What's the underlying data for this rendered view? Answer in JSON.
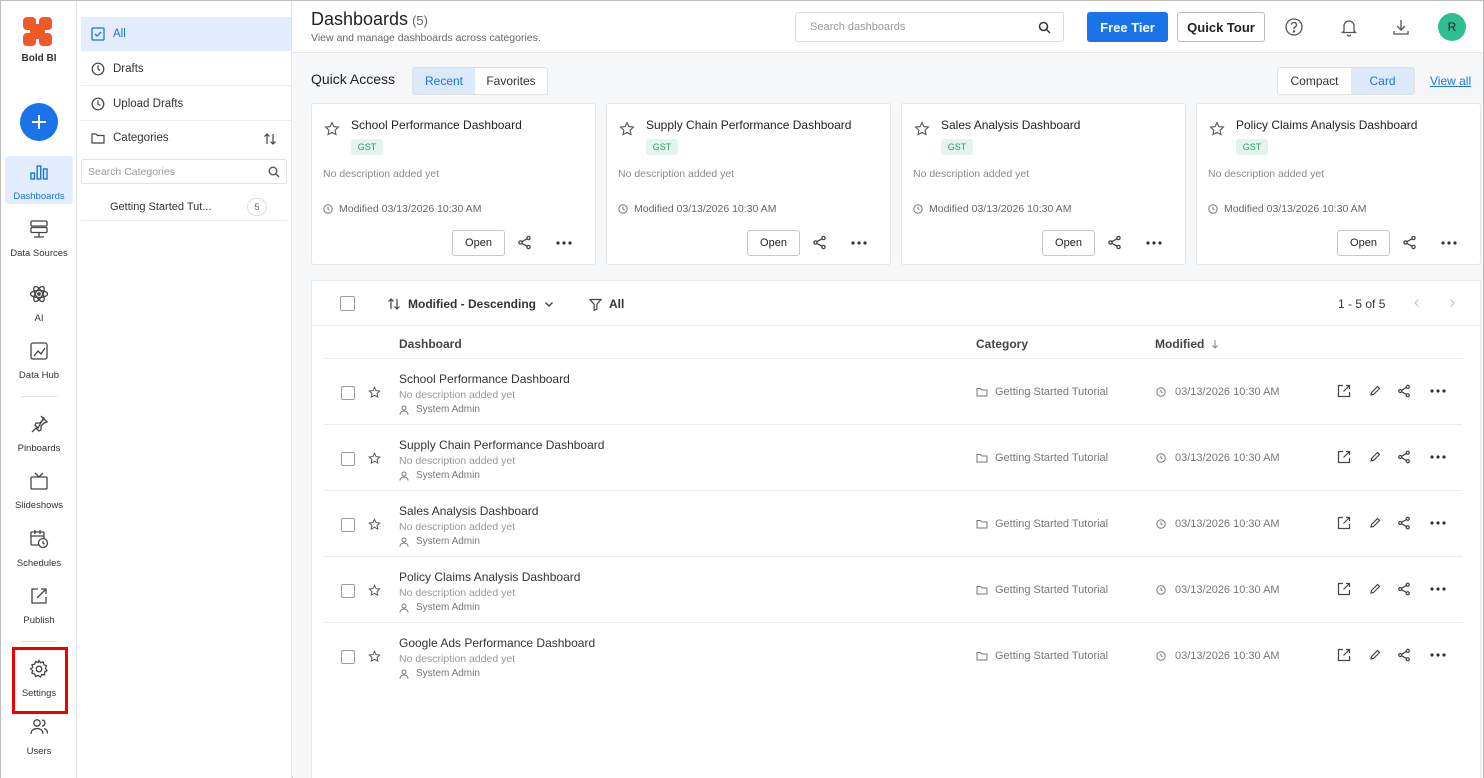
{
  "brand": {
    "name": "Bold BI"
  },
  "nav": {
    "items": [
      {
        "label": "Dashboards",
        "icon": "bar-chart-icon"
      },
      {
        "label": "Data Sources",
        "icon": "database-icon"
      },
      {
        "label": "AI",
        "icon": "atom-icon"
      },
      {
        "label": "Data Hub",
        "icon": "data-hub-icon"
      },
      {
        "label": "Pinboards",
        "icon": "pin-icon"
      },
      {
        "label": "Slideshows",
        "icon": "tv-icon"
      },
      {
        "label": "Schedules",
        "icon": "calendar-clock-icon"
      },
      {
        "label": "Publish",
        "icon": "publish-icon"
      },
      {
        "label": "Settings",
        "icon": "gear-icon"
      },
      {
        "label": "Users",
        "icon": "users-icon"
      }
    ]
  },
  "panel": {
    "items": [
      {
        "label": "All",
        "icon": "checkbox-icon"
      },
      {
        "label": "Drafts",
        "icon": "clock-icon"
      },
      {
        "label": "Upload Drafts",
        "icon": "clock-icon"
      },
      {
        "label": "Categories",
        "icon": "folder-icon"
      }
    ],
    "category_search_placeholder": "Search Categories",
    "categories": [
      {
        "label": "Getting Started Tut...",
        "count": "5"
      }
    ]
  },
  "header": {
    "title": "Dashboards",
    "count": "(5)",
    "subtitle": "View and manage dashboards across categories.",
    "search_placeholder": "Search dashboards",
    "free_tier": "Free Tier",
    "quick_tour": "Quick Tour",
    "avatar": "R"
  },
  "quick_access": {
    "title": "Quick Access",
    "tabs": [
      "Recent",
      "Favorites"
    ],
    "views": [
      "Compact",
      "Card"
    ],
    "view_all": "View all",
    "cards": [
      {
        "title": "School Performance Dashboard",
        "tag": "GST",
        "desc": "No description added yet",
        "modified": "Modified 03/13/2026 10:30 AM",
        "open": "Open"
      },
      {
        "title": "Supply Chain Performance Dashboard",
        "tag": "GST",
        "desc": "No description added yet",
        "modified": "Modified 03/13/2026 10:30 AM",
        "open": "Open"
      },
      {
        "title": "Sales Analysis Dashboard",
        "tag": "GST",
        "desc": "No description added yet",
        "modified": "Modified 03/13/2026 10:30 AM",
        "open": "Open"
      },
      {
        "title": "Policy Claims Analysis Dashboard",
        "tag": "GST",
        "desc": "No description added yet",
        "modified": "Modified 03/13/2026 10:30 AM",
        "open": "Open"
      }
    ]
  },
  "list": {
    "sort": "Modified - Descending",
    "filter": "All",
    "pager": "1 - 5 of 5",
    "columns": [
      "Dashboard",
      "Category",
      "Modified"
    ],
    "rows": [
      {
        "name": "School Performance Dashboard",
        "desc": "No description added yet",
        "owner": "System Admin",
        "category": "Getting Started Tutorial",
        "modified": "03/13/2026 10:30 AM"
      },
      {
        "name": "Supply Chain Performance Dashboard",
        "desc": "No description added yet",
        "owner": "System Admin",
        "category": "Getting Started Tutorial",
        "modified": "03/13/2026 10:30 AM"
      },
      {
        "name": "Sales Analysis Dashboard",
        "desc": "No description added yet",
        "owner": "System Admin",
        "category": "Getting Started Tutorial",
        "modified": "03/13/2026 10:30 AM"
      },
      {
        "name": "Policy Claims Analysis Dashboard",
        "desc": "No description added yet",
        "owner": "System Admin",
        "category": "Getting Started Tutorial",
        "modified": "03/13/2026 10:30 AM"
      },
      {
        "name": "Google Ads Performance Dashboard",
        "desc": "No description added yet",
        "owner": "System Admin",
        "category": "Getting Started Tutorial",
        "modified": "03/13/2026 10:30 AM"
      }
    ]
  },
  "colors": {
    "accent": "#1a73e8",
    "highlight": "#ee0000",
    "avatar": "#2ebf91",
    "tag_bg": "#e2f4ec"
  }
}
